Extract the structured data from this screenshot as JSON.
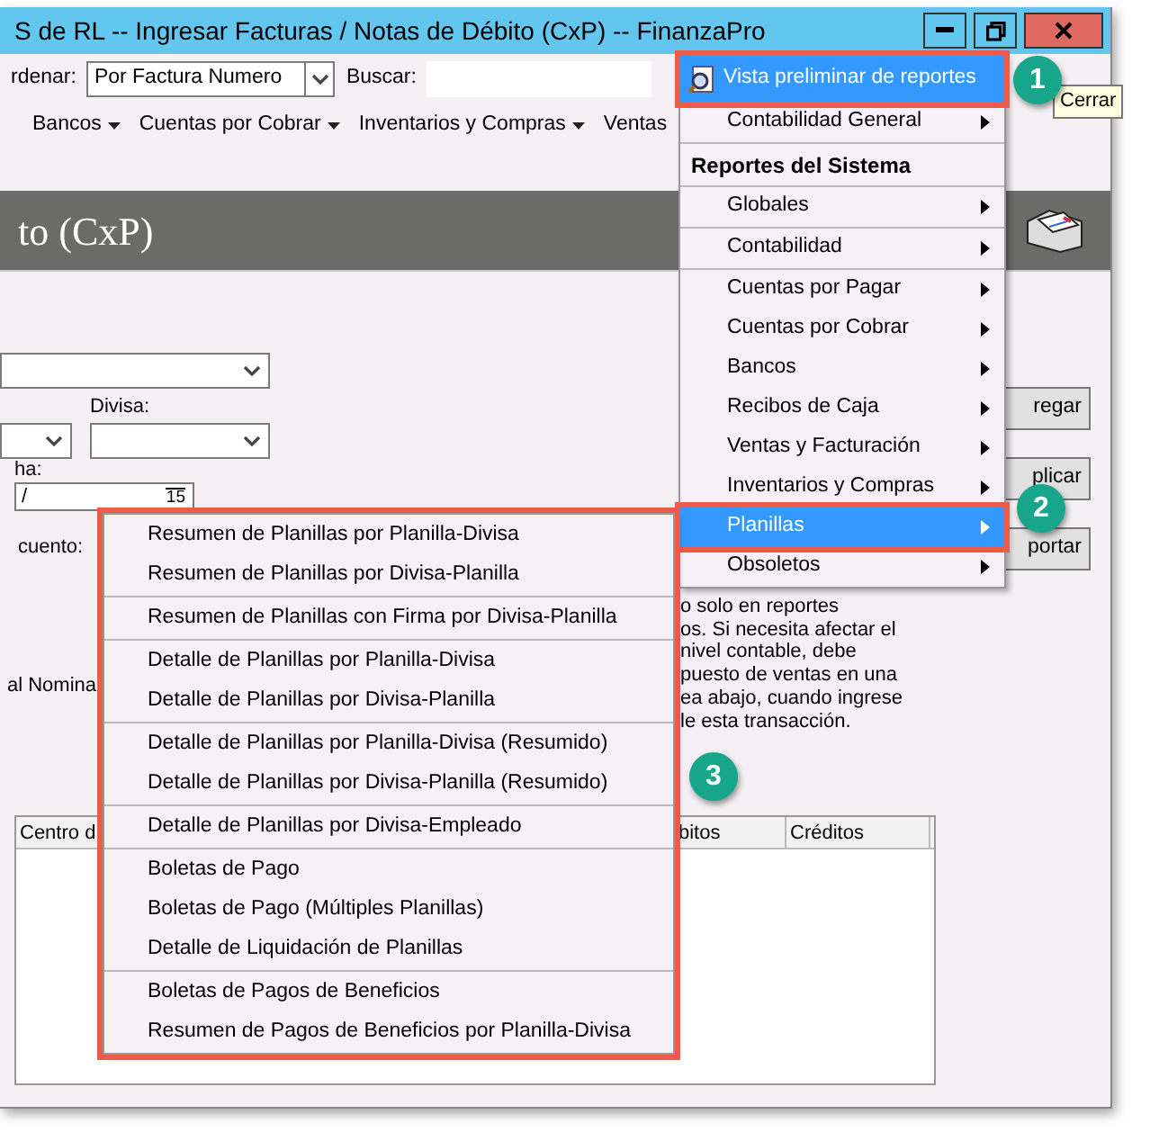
{
  "window": {
    "title": "S de RL -- Ingresar Facturas / Notas de Débito (CxP) -- FinanzaPro"
  },
  "toolbar": {
    "sort_label": "rdenar:",
    "sort_value": "Por Factura Numero",
    "search_label": "Buscar:"
  },
  "menubar": [
    {
      "label": "Bancos",
      "dropdown": true
    },
    {
      "label": "Cuentas por Cobrar",
      "dropdown": true
    },
    {
      "label": "Inventarios y Compras",
      "dropdown": true
    },
    {
      "label": "Ventas",
      "dropdown": false
    }
  ],
  "header": {
    "title": "to (CxP)"
  },
  "form": {
    "currency_label": "Divisa:",
    "date_label": "ha:",
    "date_value": "/",
    "calendar_day": "15",
    "discount_label": "cuento:",
    "nominal_label": "al Nomina",
    "buttons": [
      "regar",
      "plicar",
      "portar"
    ],
    "note_lines": [
      "o solo en reportes",
      "os. Si necesita afectar el",
      "nivel contable, debe",
      "puesto de ventas en una",
      "ea abajo, cuando ingrese",
      "le esta transacción."
    ]
  },
  "table": {
    "columns": [
      "Centro d",
      "bitos",
      "Créditos"
    ]
  },
  "reports_menu": [
    {
      "kind": "action",
      "label": "Vista preliminar de reportes",
      "selected": true,
      "submenu": false
    },
    {
      "kind": "item",
      "label": "Contabilidad General",
      "selected": false,
      "submenu": true
    },
    {
      "kind": "header",
      "label": "Reportes del Sistema"
    },
    {
      "kind": "item",
      "label": "Globales",
      "selected": false,
      "submenu": true
    },
    {
      "kind": "item",
      "label": "Contabilidad",
      "selected": false,
      "submenu": true
    },
    {
      "kind": "item",
      "label": "Cuentas por Pagar",
      "selected": false,
      "submenu": true
    },
    {
      "kind": "item",
      "label": "Cuentas por Cobrar",
      "selected": false,
      "submenu": true
    },
    {
      "kind": "item",
      "label": "Bancos",
      "selected": false,
      "submenu": true
    },
    {
      "kind": "item",
      "label": "Recibos de Caja",
      "selected": false,
      "submenu": true
    },
    {
      "kind": "item",
      "label": "Ventas y Facturación",
      "selected": false,
      "submenu": true
    },
    {
      "kind": "item",
      "label": "Inventarios y Compras",
      "selected": false,
      "submenu": true
    },
    {
      "kind": "item",
      "label": "Planillas",
      "selected": true,
      "submenu": true
    },
    {
      "kind": "item",
      "label": "Obsoletos",
      "selected": false,
      "submenu": true
    }
  ],
  "planillas_submenu": [
    [
      "Resumen de Planillas por Planilla-Divisa",
      "Resumen de Planillas por Divisa-Planilla"
    ],
    [
      "Resumen de Planillas con Firma por Divisa-Planilla"
    ],
    [
      "Detalle de Planillas por Planilla-Divisa",
      "Detalle de Planillas por Divisa-Planilla"
    ],
    [
      "Detalle de Planillas por Planilla-Divisa (Resumido)",
      "Detalle de Planillas por Divisa-Planilla (Resumido)"
    ],
    [
      "Detalle de Planillas por Divisa-Empleado"
    ],
    [
      "Boletas de Pago",
      "Boletas de Pago (Múltiples Planillas)",
      "Detalle de Liquidación de Planillas"
    ],
    [
      "Boletas de Pagos de Beneficios",
      "Resumen de Pagos de Beneficios por Planilla-Divisa"
    ]
  ],
  "tooltip": "Cerrar",
  "callouts": [
    "1",
    "2",
    "3"
  ]
}
